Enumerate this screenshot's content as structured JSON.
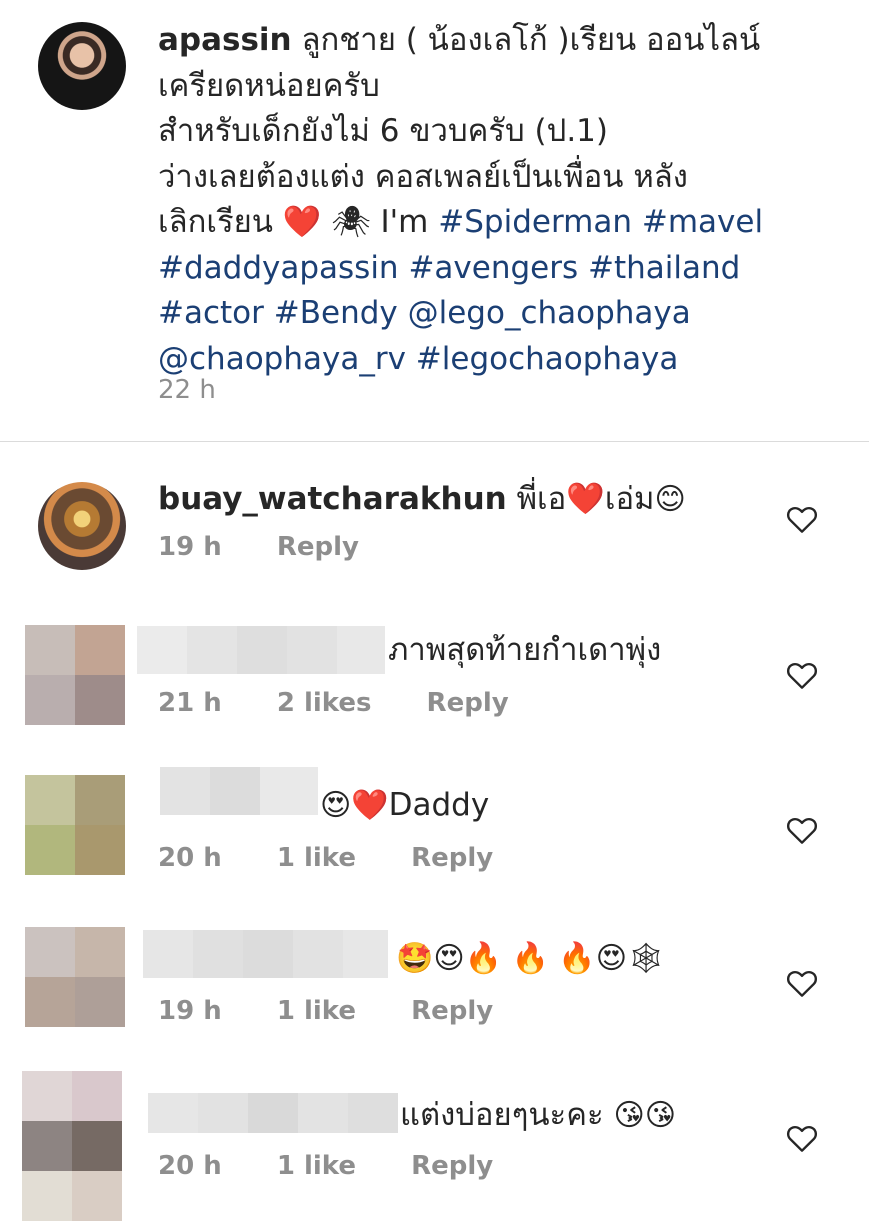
{
  "post": {
    "username": "apassin",
    "caption_line1": "ลูกชาย ( น้องเลโก้ )เรียน ออนไลน์",
    "caption_line2": "เครียดหน่อยครับ",
    "caption_line3": "สำหรับเด็กยังไม่ 6 ขวบครับ (ป.1)",
    "caption_line4": "ว่างเลยต้องแต่ง คอสเพลย์เป็นเพื่อน หลัง",
    "caption_line5_text": "เลิกเรียน",
    "caption_line5_heart": "❤️",
    "caption_line5_spider": "🕷",
    "caption_line5_im": "I'm",
    "tags": {
      "spiderman": "#Spiderman",
      "mavel": "#mavel",
      "daddyapassin": "#daddyapassin",
      "avengers": "#avengers",
      "thailand": "#thailand",
      "actor": "#actor",
      "bendy": "#Bendy",
      "lego_chaophaya": "@lego_chaophaya",
      "chaophaya_rv": "@chaophaya_rv",
      "legochaophaya": "#legochaophaya"
    },
    "time": "22 h"
  },
  "comments": [
    {
      "username": "buay_watcharakhun",
      "text_before": "พี่เอ",
      "heart": "❤️",
      "text_after": "เอ่ม",
      "emoji": "😊",
      "time": "19 h",
      "reply": "Reply"
    },
    {
      "text": "ภาพสุดท้ายกำเดาพุ่ง",
      "time": "21 h",
      "likes": "2 likes",
      "reply": "Reply"
    },
    {
      "emoji": "😍❤️",
      "text": "Daddy",
      "time": "20 h",
      "likes": "1 like",
      "reply": "Reply"
    },
    {
      "emoji": "🤩😍🔥 🔥 🔥😍🕸",
      "time": "19 h",
      "likes": "1 like",
      "reply": "Reply"
    },
    {
      "text": "แต่งบ่อยๆนะคะ",
      "emoji": "😘😘",
      "time": "20 h",
      "likes": "1 like",
      "reply": "Reply"
    }
  ],
  "icons": {
    "like": "heart-outline-icon"
  }
}
